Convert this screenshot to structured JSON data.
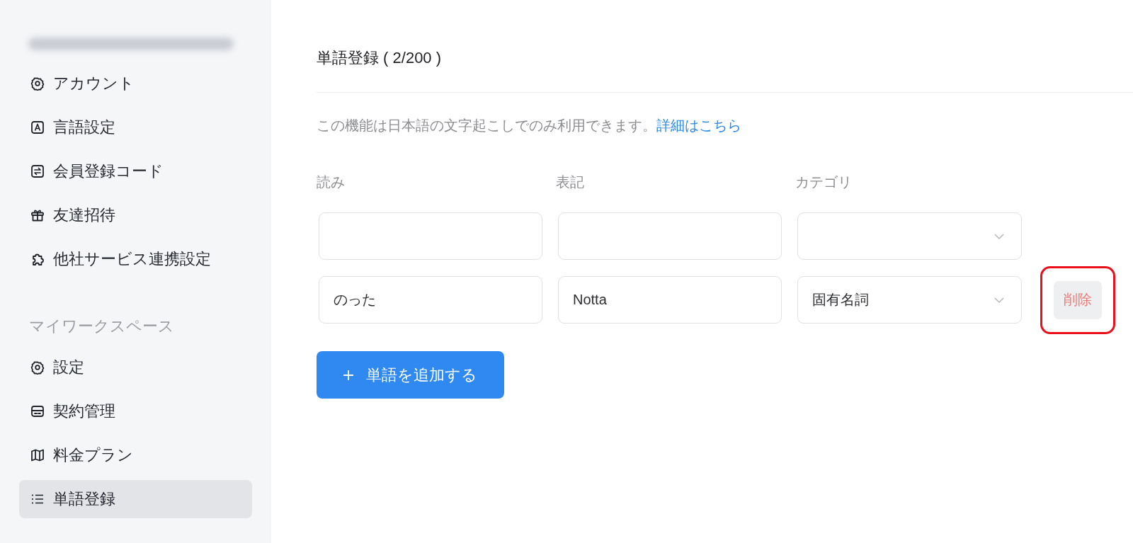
{
  "sidebar": {
    "account_items": [
      {
        "kind": "account",
        "label": "アカウント",
        "selected": false
      },
      {
        "kind": "language",
        "label": "言語設定",
        "selected": false
      },
      {
        "kind": "code",
        "label": "会員登録コード",
        "selected": false
      },
      {
        "kind": "invite",
        "label": "友達招待",
        "selected": false
      },
      {
        "kind": "integration",
        "label": "他社サービス連携設定",
        "selected": false
      }
    ],
    "workspace": {
      "heading": "マイワークスペース",
      "items": [
        {
          "kind": "settings",
          "label": "設定",
          "selected": false
        },
        {
          "kind": "contract",
          "label": "契約管理",
          "selected": false
        },
        {
          "kind": "pricing",
          "label": "料金プラン",
          "selected": false
        },
        {
          "kind": "dictionary",
          "label": "単語登録",
          "selected": true
        }
      ]
    }
  },
  "page": {
    "title": "単語登録 ( 2/200 )",
    "notice": {
      "text": "この機能は日本語の文字起こしでのみ利用できます。",
      "link": "詳細はこちら"
    },
    "columns": [
      "読み",
      "表記",
      "カテゴリ"
    ],
    "rows": [
      {},
      {
        "reading": "のった",
        "notation": "Notta",
        "category": "固有名詞",
        "delete_button": {
          "label": "削除",
          "highlighted": true
        }
      }
    ],
    "add_button": {
      "label": "単語を追加する"
    }
  }
}
